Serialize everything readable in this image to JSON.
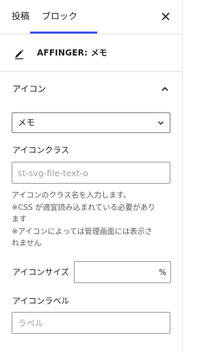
{
  "tabs": [
    {
      "label": "投稿"
    },
    {
      "label": "ブロック"
    }
  ],
  "block_card": {
    "title": "AFFINGER: メモ"
  },
  "section": {
    "title": "アイコン"
  },
  "icon_select": {
    "value": "メモ"
  },
  "icon_class": {
    "label": "アイコンクラス",
    "placeholder": "st-svg-file-text-o"
  },
  "help_text": [
    "アイコンのクラス名を入力します。",
    "※CSS が適宜読み込まれている必要があり",
    "ます",
    "※アイコンによっては管理画面には表示さ",
    "れません"
  ],
  "icon_size": {
    "label": "アイコンサイズ",
    "unit": "%"
  },
  "icon_label": {
    "label": "アイコンラベル",
    "placeholder": "ラベル"
  },
  "colors": {
    "accent": "#3858e9",
    "border": "#e0e0e0"
  }
}
